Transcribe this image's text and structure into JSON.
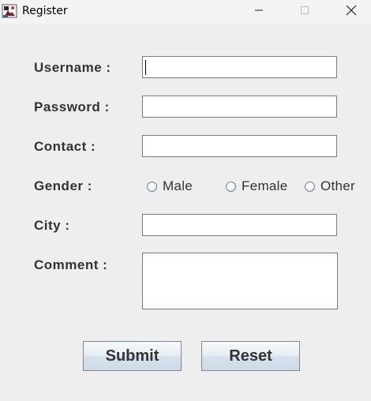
{
  "window": {
    "title": "Register",
    "icon": "java-app-icon",
    "controls": {
      "minimize": "minimize-icon",
      "maximize": "maximize-icon",
      "close": "close-icon"
    }
  },
  "form": {
    "username": {
      "label": "Username :",
      "value": ""
    },
    "password": {
      "label": "Password :",
      "value": ""
    },
    "contact": {
      "label": "Contact :",
      "value": ""
    },
    "gender": {
      "label": "Gender :",
      "options": [
        "Male",
        "Female",
        "Other"
      ],
      "selected": null
    },
    "city": {
      "label": "City :",
      "value": ""
    },
    "comment": {
      "label": "Comment :",
      "value": ""
    }
  },
  "buttons": {
    "submit": "Submit",
    "reset": "Reset"
  }
}
